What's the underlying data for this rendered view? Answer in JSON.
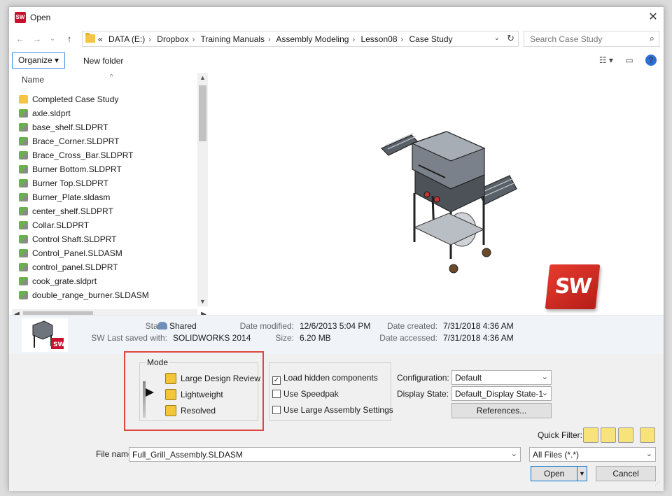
{
  "window": {
    "title": "Open",
    "close_glyph": "✕",
    "app_icon_text": "SW"
  },
  "nav": {
    "back": "←",
    "forward": "→",
    "dropdown": "⌄",
    "up": "↑",
    "breadcrumb_prefix": "«",
    "breadcrumbs": [
      "DATA (E:)",
      "Dropbox",
      "Training Manuals",
      "Assembly Modeling",
      "Lesson08",
      "Case Study"
    ],
    "separator": "›",
    "refresh": "↻",
    "search_placeholder": "Search Case Study"
  },
  "toolbar": {
    "organize_label": "Organize ▾",
    "new_folder_label": "New folder",
    "view_glyph": "☷ ▾",
    "pane_glyph": "▭",
    "help_glyph": "?"
  },
  "filelist": {
    "column_header": "Name",
    "items": [
      {
        "name": "Completed Case Study",
        "kind": "folder"
      },
      {
        "name": "axle.sldprt",
        "kind": "part"
      },
      {
        "name": "base_shelf.SLDPRT",
        "kind": "part"
      },
      {
        "name": "Brace_Corner.SLDPRT",
        "kind": "part"
      },
      {
        "name": "Brace_Cross_Bar.SLDPRT",
        "kind": "part"
      },
      {
        "name": "Burner Bottom.SLDPRT",
        "kind": "part"
      },
      {
        "name": "Burner Top.SLDPRT",
        "kind": "part"
      },
      {
        "name": "Burner_Plate.sldasm",
        "kind": "assembly"
      },
      {
        "name": "center_shelf.SLDPRT",
        "kind": "part"
      },
      {
        "name": "Collar.SLDPRT",
        "kind": "part"
      },
      {
        "name": "Control Shaft.SLDPRT",
        "kind": "part"
      },
      {
        "name": "Control_Panel.SLDASM",
        "kind": "assembly"
      },
      {
        "name": "control_panel.SLDPRT",
        "kind": "part"
      },
      {
        "name": "cook_grate.sldprt",
        "kind": "part"
      },
      {
        "name": "double_range_burner.SLDASM",
        "kind": "assembly"
      }
    ]
  },
  "preview": {
    "logo_text": "SW"
  },
  "details": {
    "state_label": "State:",
    "state_value": "Shared",
    "saved_label": "SW Last saved with:",
    "saved_value": "SOLIDWORKS 2014",
    "modified_label": "Date modified:",
    "modified_value": "12/6/2013 5:04 PM",
    "size_label": "Size:",
    "size_value": "6.20 MB",
    "created_label": "Date created:",
    "created_value": "7/31/2018 4:36 AM",
    "accessed_label": "Date accessed:",
    "accessed_value": "7/31/2018 4:36 AM"
  },
  "mode": {
    "legend": "Mode",
    "options": [
      "Large Design Review",
      "Lightweight",
      "Resolved"
    ],
    "selected": "Lightweight"
  },
  "options": {
    "load_hidden": {
      "label": "Load hidden components",
      "checked": true
    },
    "speedpak": {
      "label": "Use Speedpak",
      "checked": false
    },
    "large_assembly": {
      "label": "Use Large Assembly Settings",
      "checked": false
    }
  },
  "configuration": {
    "label": "Configuration:",
    "value": "Default"
  },
  "display_state": {
    "label": "Display State:",
    "value": "Default_Display State-1"
  },
  "references_label": "References...",
  "quick_filter_label": "Quick Filter:",
  "file_name": {
    "label": "File name:",
    "value": "Full_Grill_Assembly.SLDASM"
  },
  "file_type": {
    "value": "All Files (*.*)"
  },
  "open_label": "Open",
  "cancel_label": "Cancel",
  "colors": {
    "accent": "#0078d7",
    "highlight_box": "#e0463c",
    "sw_red": "#c8102e"
  }
}
